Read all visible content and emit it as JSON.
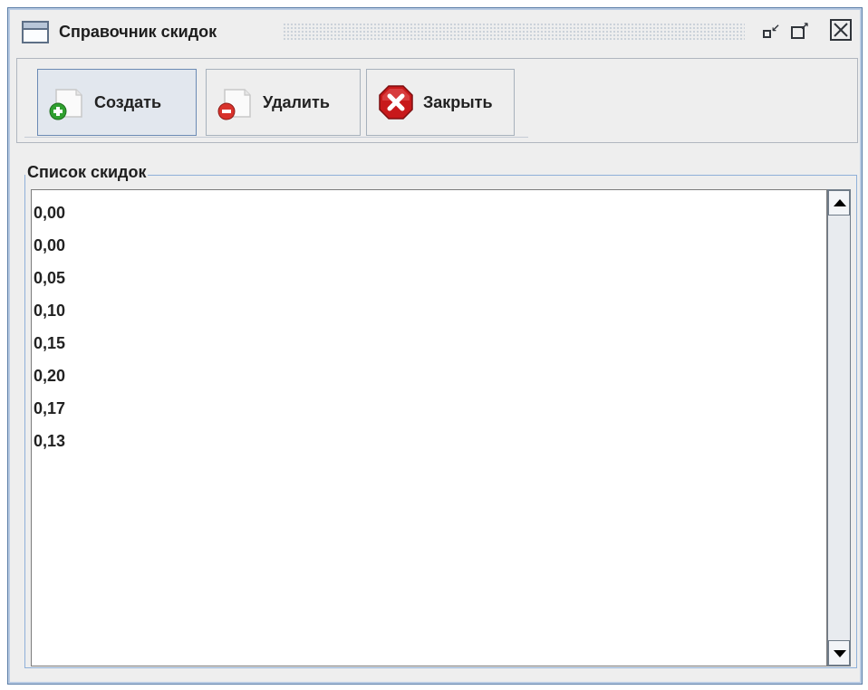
{
  "window": {
    "title": "Справочник скидок",
    "title_icon": "window-icon",
    "controls": [
      "minimize-icon",
      "maximize-icon",
      "close-icon"
    ]
  },
  "toolbar": {
    "create_label": "Создать",
    "delete_label": "Удалить",
    "close_label": "Закрыть"
  },
  "list_group": {
    "title": "Список скидок",
    "items": [
      "0,00",
      "0,00",
      "0,05",
      "0,10",
      "0,15",
      "0,20",
      "0,17",
      "0,13"
    ]
  },
  "colors": {
    "frame_border": "#5b7ea8",
    "group_border": "#8fb0d9",
    "create_green": "#2f9f2f",
    "delete_red": "#d8322c",
    "close_red": "#c8191b"
  }
}
